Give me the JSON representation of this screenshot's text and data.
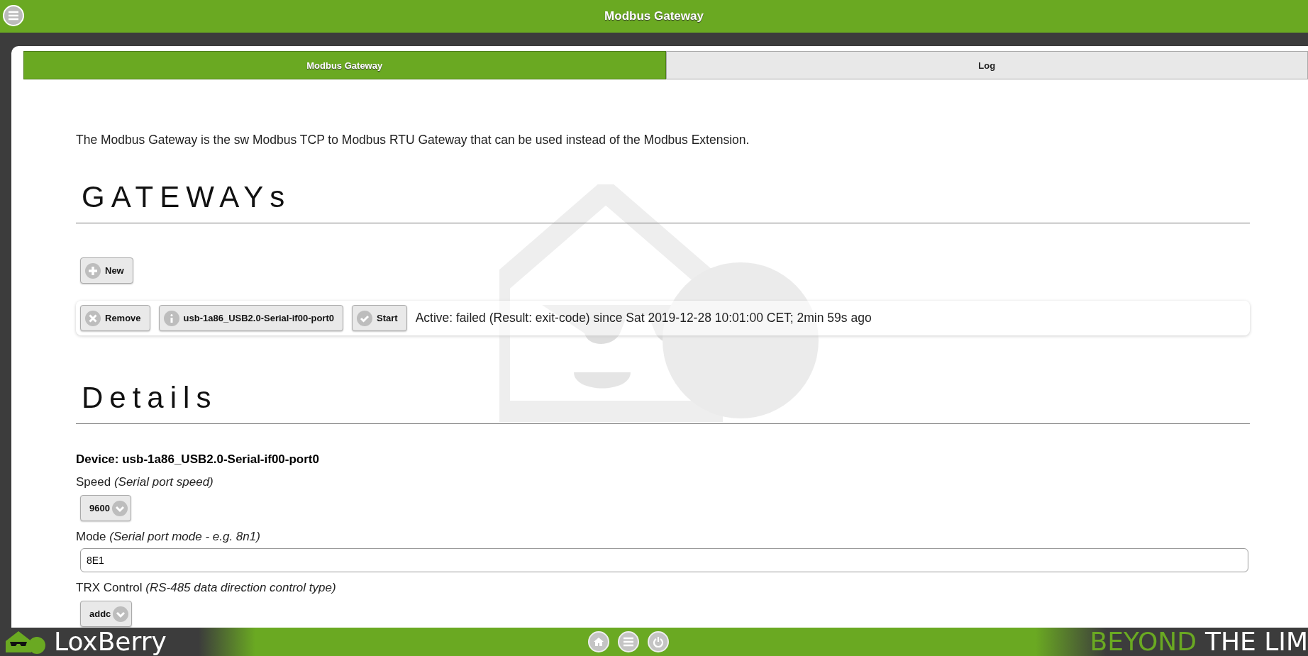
{
  "header": {
    "title": "Modbus Gateway"
  },
  "tabs": [
    {
      "label": "Modbus Gateway",
      "selected": true
    },
    {
      "label": "Log",
      "selected": false
    }
  ],
  "intro": "The Modbus Gateway is the sw Modbus TCP to Modbus RTU Gateway that can be used instead of the Modbus Extension.",
  "gateways": {
    "heading": "GATEWAYs",
    "new_button": "New",
    "items": [
      {
        "remove_button": "Remove",
        "device_button": "usb-1a86_USB2.0-Serial-if00-port0",
        "start_button": "Start",
        "status": "Active: failed (Result: exit-code) since Sat 2019-12-28 10:01:00 CET; 2min 59s ago"
      }
    ]
  },
  "details": {
    "heading": "Details",
    "device": "Device: usb-1a86_USB2.0-Serial-if00-port0",
    "fields": [
      {
        "kind": "select",
        "label": "Speed",
        "hint": "(Serial port speed)",
        "value": "9600"
      },
      {
        "kind": "text",
        "label": "Mode",
        "hint": "(Serial port mode - e.g. 8n1)",
        "value": "8E1"
      },
      {
        "kind": "select",
        "label": "TRX Control",
        "hint": "(RS-485 data direction control type)",
        "value": "addc"
      }
    ]
  },
  "footer": {
    "brand": "LoxBerry",
    "slogan_1": "BEYOND",
    "slogan_2": "THE LIM"
  }
}
